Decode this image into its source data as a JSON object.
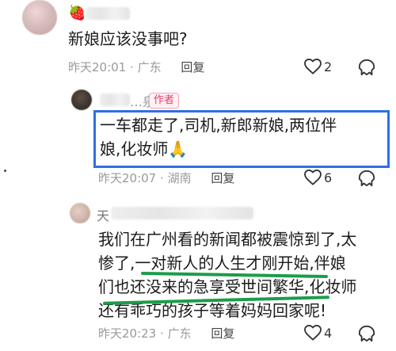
{
  "comments": [
    {
      "badge_emoji": "🍓",
      "text": "新娘应该没事吧?",
      "time": "昨天20:01",
      "location": "广东",
      "reply_label": "回复",
      "likes": "2"
    },
    {
      "name_fragment": "…泉",
      "author_badge": "作者",
      "text_line1": "一车都走了,司机,新郎新娘,两位伴",
      "text_line2": "娘,化妆师🙏",
      "time": "昨天20:07",
      "location": "湖南",
      "reply_label": "回复",
      "likes": "6"
    },
    {
      "name_fragment": "天",
      "text_line1": "我们在广州看的新闻都被震惊到了,太",
      "text_line2": "惨了,一对新人的人生才刚开始,伴娘",
      "text_line3": "们也还没来的急享受世间繁华,化妆师",
      "text_line4": "还有乖巧的孩子等着妈妈回家呢!",
      "time": "昨天20:23",
      "location": "广东",
      "reply_label": "回复",
      "likes": "4"
    }
  ],
  "colors": {
    "highlight_box": "#2f6fe4",
    "underline": "#1c9c4a",
    "author_badge": "#e23f6a"
  },
  "icons": [
    "heart-icon",
    "dislike-icon"
  ]
}
